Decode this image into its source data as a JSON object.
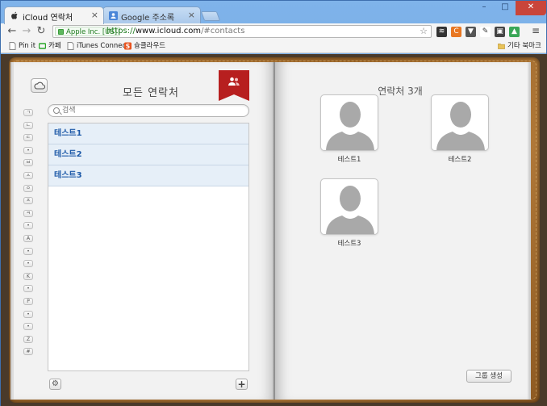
{
  "browser": {
    "tabs": [
      {
        "label": "iCloud 연락처",
        "active": true
      },
      {
        "label": "Google 주소록",
        "active": false
      }
    ],
    "address": {
      "ev_label": "Apple Inc. [US]",
      "scheme": "https://",
      "host": "www.icloud.com",
      "path": "/#contacts"
    },
    "bookmarks": [
      {
        "label": "Pin it",
        "icon": "page-icon"
      },
      {
        "label": "카페",
        "icon": "cafe-icon"
      },
      {
        "label": "iTunes Connect",
        "icon": "page-icon"
      },
      {
        "label": "슝클라우드",
        "icon": "s-app-icon"
      }
    ],
    "other_bookmarks": "기타 북마크",
    "window_controls": {
      "min": "–",
      "max": "□",
      "close": "✕"
    }
  },
  "contacts": {
    "left": {
      "title": "모든 연락처",
      "search_placeholder": "검색",
      "index": [
        "ㄱ",
        "ㄴ",
        "ㄷ",
        "•",
        "ㅂ",
        "ㅅ",
        "ㅇ",
        "ㅈ",
        "ㅋ",
        "•",
        "A",
        "•",
        "•",
        "K",
        "•",
        "P",
        "•",
        "•",
        "Z",
        "#"
      ],
      "rows": [
        "테스트1",
        "테스트2",
        "테스트3"
      ]
    },
    "right": {
      "title": "연락처 3개",
      "cards": [
        "테스트1",
        "테스트2",
        "테스트3"
      ],
      "new_group_label": "그룹 생성"
    }
  },
  "colors": {
    "accent": "#1e5aa8",
    "ribbon": "#b71f1f",
    "row_bg": "#e6eff8"
  }
}
